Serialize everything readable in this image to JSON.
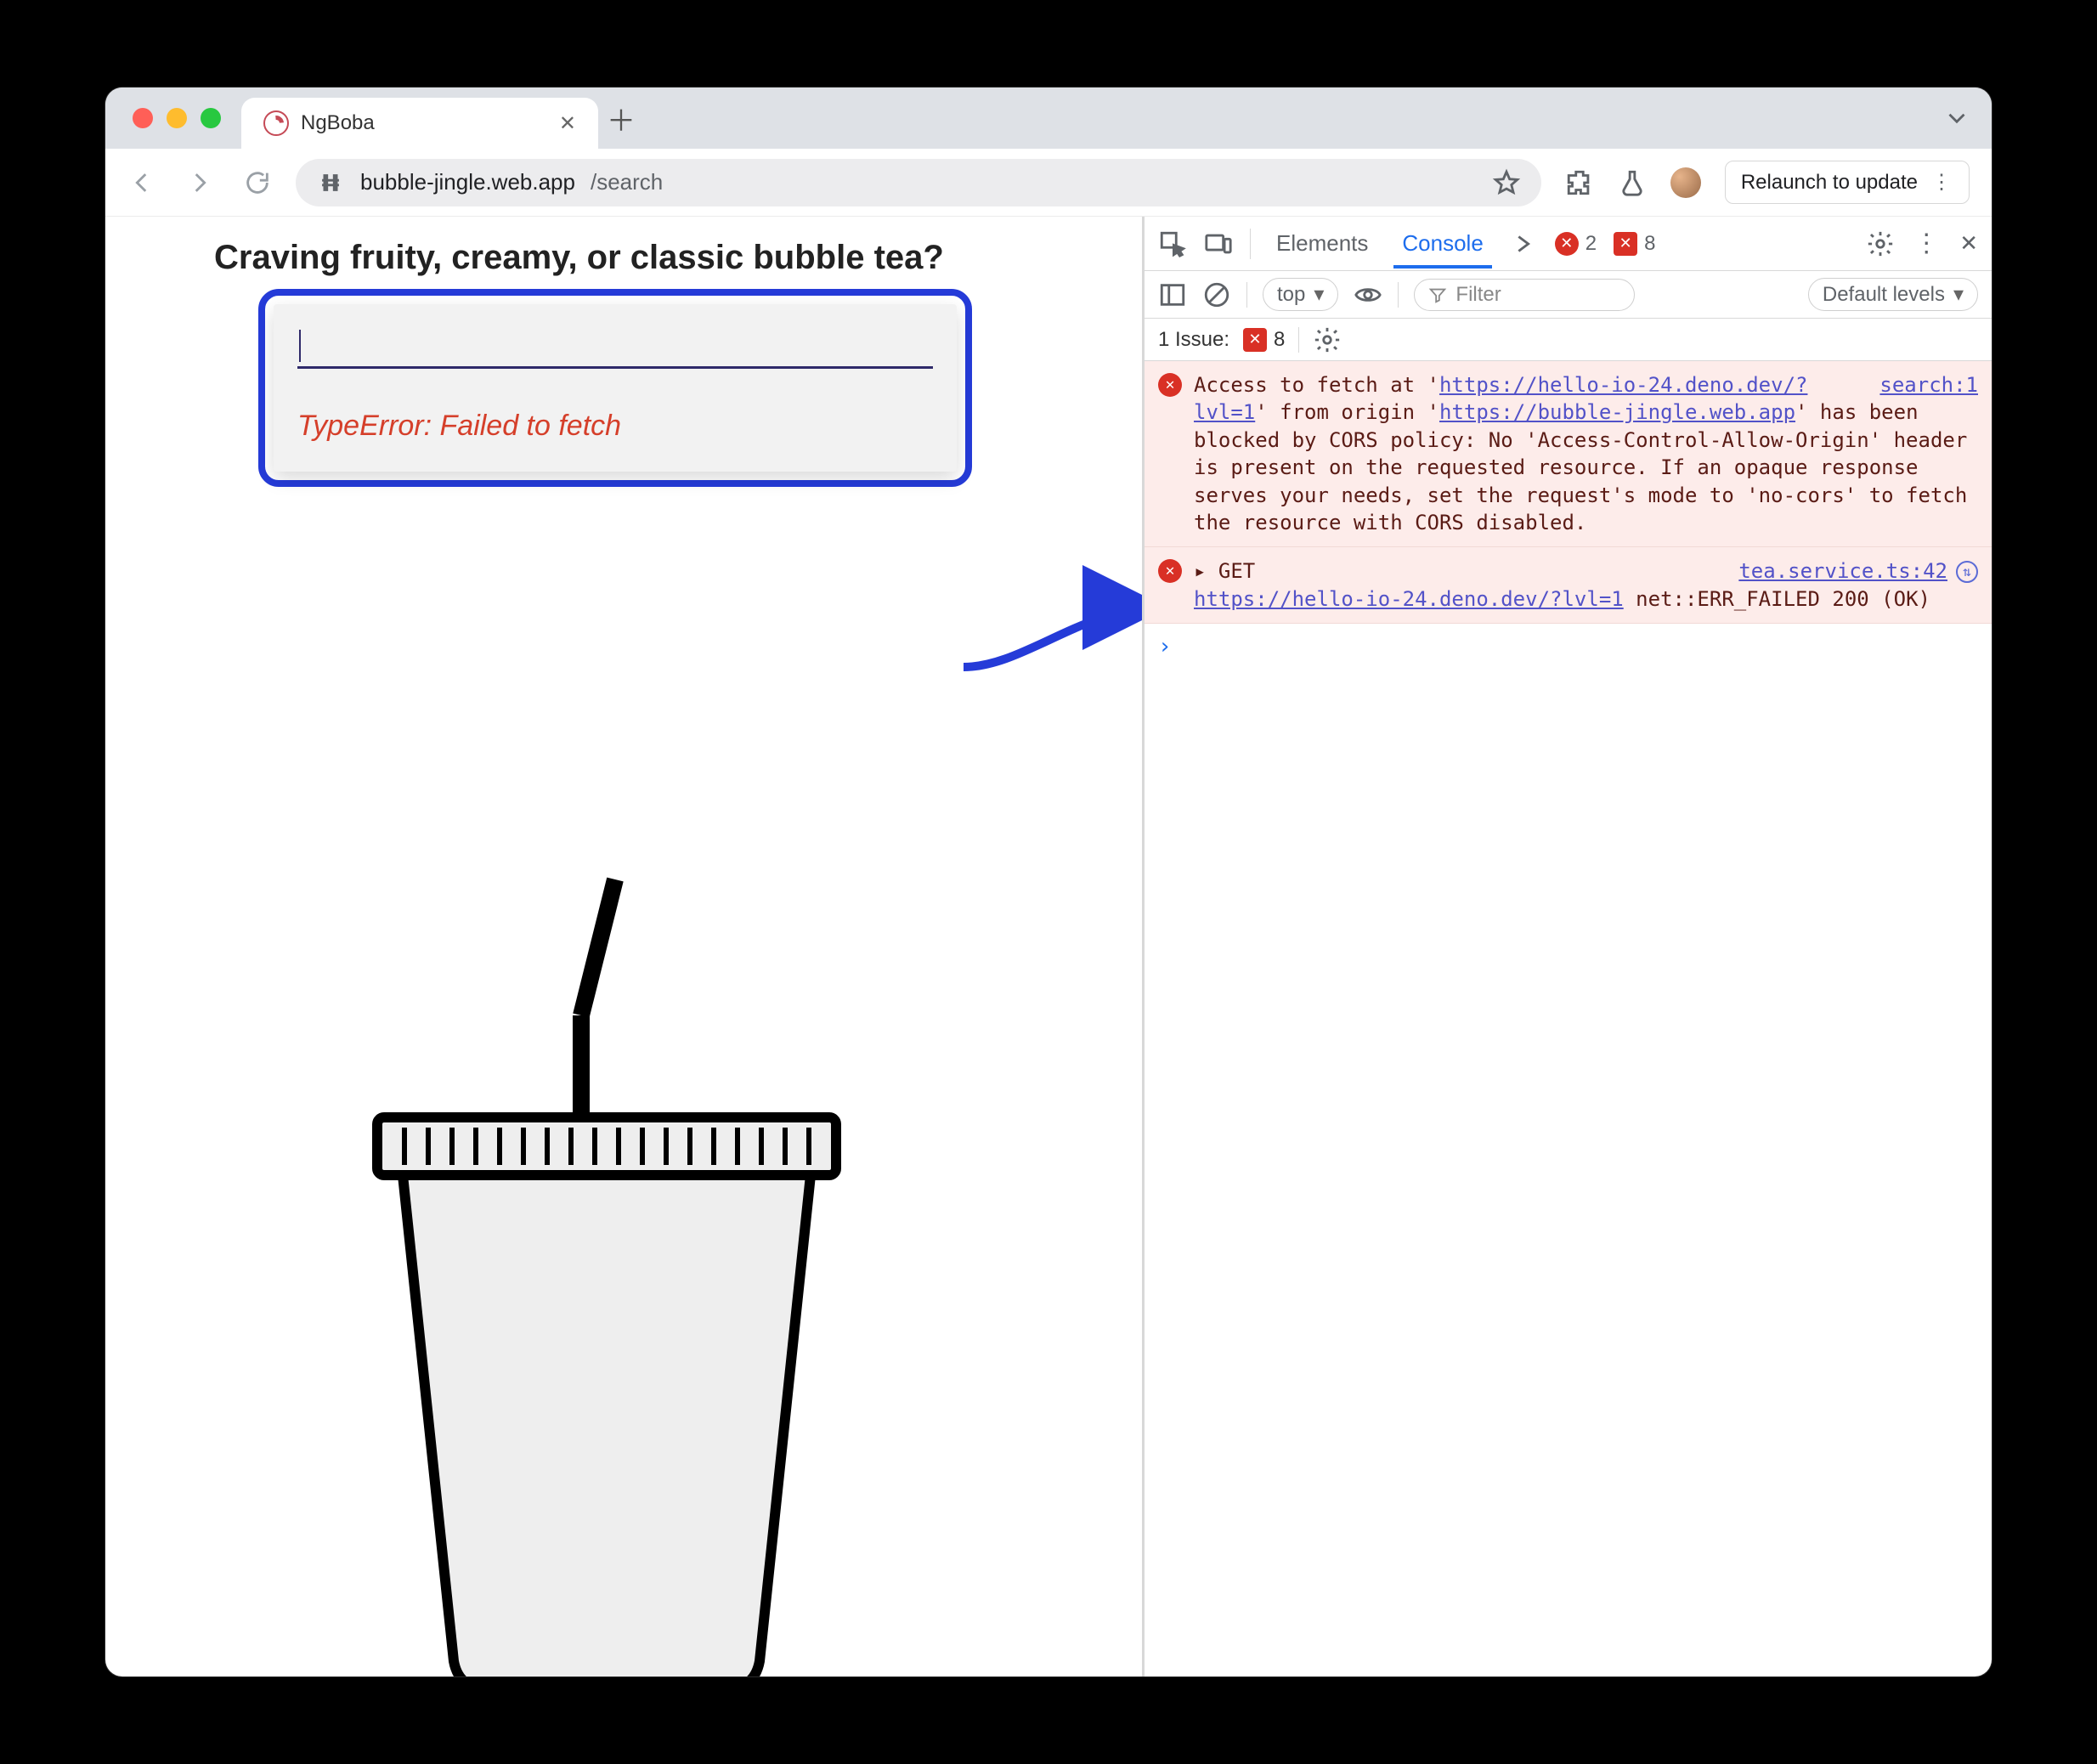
{
  "browser": {
    "tab_title": "NgBoba",
    "url_host": "bubble-jingle.web.app",
    "url_path": "/search",
    "relaunch_label": "Relaunch to update"
  },
  "page": {
    "heading": "Craving fruity, creamy, or classic bubble tea?",
    "error_message": "TypeError: Failed to fetch"
  },
  "devtools": {
    "tabs": {
      "elements": "Elements",
      "console": "Console"
    },
    "error_count": "2",
    "warn_count": "8",
    "subbar": {
      "context": "top",
      "filter_placeholder": "Filter",
      "levels": "Default levels"
    },
    "issuebar": {
      "label": "1 Issue:",
      "count": "8"
    },
    "entries": [
      {
        "source": "search:1",
        "pre1": "Access to fetch at '",
        "url1": "https://hello-io-24.deno.dev/?lvl=1",
        "mid1": "' from origin '",
        "url2": "https://bubble-jingle.web.app",
        "post": "' has been blocked by CORS policy: No 'Access-Control-Allow-Origin' header is present on the requested resource. If an opaque response serves your needs, set the request's mode to 'no-cors' to fetch the resource with CORS disabled."
      },
      {
        "source": "tea.service.ts:42",
        "line1a": "▸ GET",
        "url": "https://hello-io-24.deno.dev/?lvl=1",
        "tail": " net::ERR_FAILED 200 (OK)"
      }
    ]
  }
}
